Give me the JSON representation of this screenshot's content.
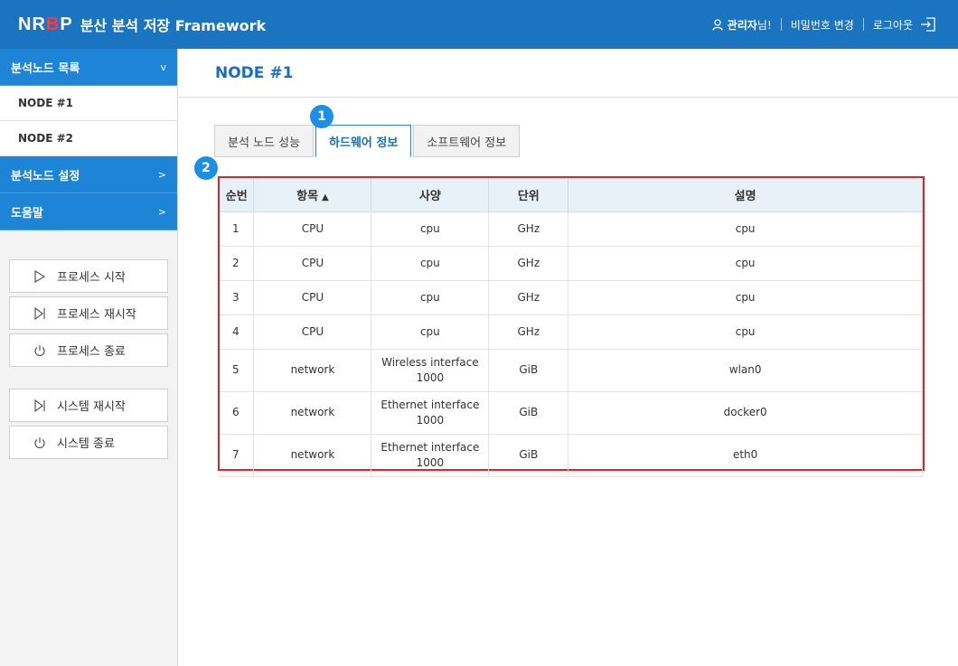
{
  "header": {
    "logo_prefix": "NR",
    "logo_accent": "B",
    "logo_suffix": "P",
    "title": "분산 분석 저장 Framework",
    "user_name": "관리자",
    "user_suffix": "님!",
    "change_password": "비밀번호 변경",
    "logout": "로그아웃"
  },
  "sidebar": {
    "menus": [
      {
        "label": "분석노드 목록",
        "arrow": "v"
      },
      {
        "label": "분석노드 설정",
        "arrow": ">"
      },
      {
        "label": "도움말",
        "arrow": ">"
      }
    ],
    "nodes": [
      "NODE #1",
      "NODE #2"
    ],
    "process_buttons": [
      "프로세스 시작",
      "프로세스 재시작",
      "프로세스 종료"
    ],
    "system_buttons": [
      "시스템 재시작",
      "시스템 종료"
    ]
  },
  "main": {
    "title": "NODE #1",
    "tabs": [
      "분석 노드 성능",
      "하드웨어 정보",
      "소프트웨어 정보"
    ],
    "active_tab": 1,
    "badges": [
      "1",
      "2"
    ],
    "table": {
      "headers": [
        "순번",
        "항목",
        "사양",
        "단위",
        "설명"
      ],
      "sort_indicator": "▲",
      "rows": [
        {
          "no": "1",
          "item": "CPU",
          "spec": "cpu",
          "spec2": "",
          "unit": "GHz",
          "desc": "cpu"
        },
        {
          "no": "2",
          "item": "CPU",
          "spec": "cpu",
          "spec2": "",
          "unit": "GHz",
          "desc": "cpu"
        },
        {
          "no": "3",
          "item": "CPU",
          "spec": "cpu",
          "spec2": "",
          "unit": "GHz",
          "desc": "cpu"
        },
        {
          "no": "4",
          "item": "CPU",
          "spec": "cpu",
          "spec2": "",
          "unit": "GHz",
          "desc": "cpu"
        },
        {
          "no": "5",
          "item": "network",
          "spec": "Wireless interface",
          "spec2": "1000",
          "unit": "GiB",
          "desc": "wlan0"
        },
        {
          "no": "6",
          "item": "network",
          "spec": "Ethernet interface",
          "spec2": "1000",
          "unit": "GiB",
          "desc": "docker0"
        },
        {
          "no": "7",
          "item": "network",
          "spec": "Ethernet interface",
          "spec2": "1000",
          "unit": "GiB",
          "desc": "eth0"
        }
      ]
    }
  },
  "colors": {
    "header_bg": "#1a74c0",
    "menu_bg": "#1e84d6",
    "highlight_border": "#e0242b",
    "badge_bg": "#1e8fe6"
  }
}
